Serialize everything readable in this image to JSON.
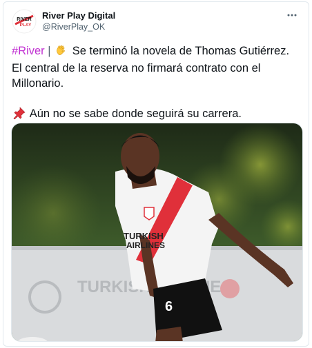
{
  "account": {
    "display_name": "River Play Digital",
    "handle": "@RiverPlay_OK",
    "avatar_logo_text": "RIVER PLAY"
  },
  "header": {
    "more_icon": "ellipsis-icon"
  },
  "tweet": {
    "hashtag": "#River",
    "separator": "|",
    "emoji_wave": "waving-hand",
    "line1_text": "Se terminó la novela de Thomas Gutiérrez.",
    "line2_text": "El central de la reserva no firmará contrato con el",
    "line3_text": "Millonario.",
    "emoji_pin": "pushpin",
    "line4_text": "Aún no se sabe donde seguirá su carrera."
  },
  "media": {
    "jersey_sponsor_line1": "TURKISH",
    "jersey_sponsor_line2": "AIRLINES",
    "background_banner_text": "TURKISH AIRLINES",
    "shorts_number": "6"
  },
  "colors": {
    "hashtag": "#c02fd1",
    "secondary_text": "#536471",
    "border": "#e1e8ed",
    "jersey_red": "#e0303a"
  }
}
